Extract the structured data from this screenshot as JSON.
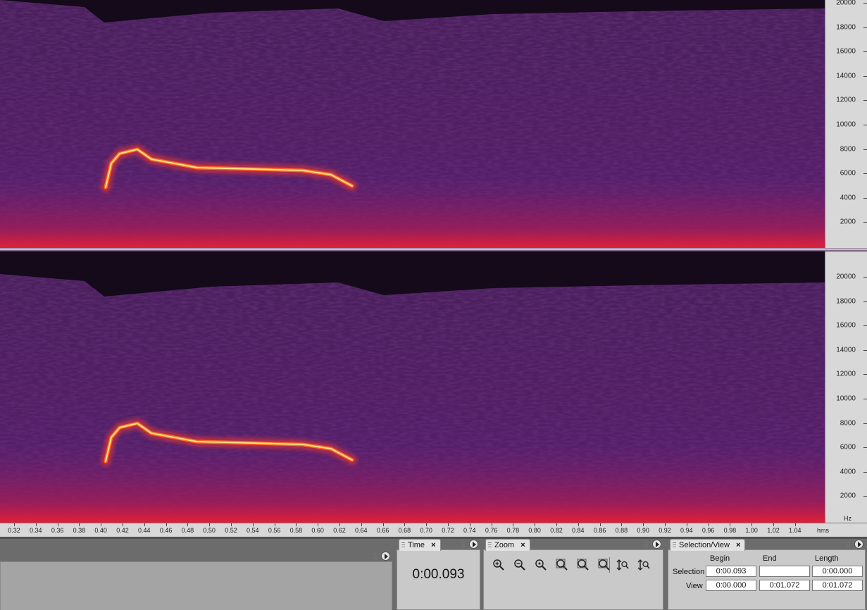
{
  "spectrogram": {
    "frequency_ruler": {
      "labels": [
        "20000",
        "18000",
        "16000",
        "14000",
        "12000",
        "10000",
        "8000",
        "6000",
        "4000",
        "2000"
      ],
      "unit": "Hz"
    },
    "time_ruler": {
      "labels": [
        "0.32",
        "0.34",
        "0.36",
        "0.38",
        "0.40",
        "0.42",
        "0.44",
        "0.46",
        "0.48",
        "0.50",
        "0.52",
        "0.54",
        "0.56",
        "0.58",
        "0.60",
        "0.62",
        "0.64",
        "0.66",
        "0.68",
        "0.70",
        "0.72",
        "0.74",
        "0.76",
        "0.78",
        "0.80",
        "0.82",
        "0.84",
        "0.86",
        "0.88",
        "0.90",
        "0.92",
        "0.94",
        "0.96",
        "0.98",
        "1.00",
        "1.02",
        "1.04"
      ],
      "unit": "hms"
    },
    "colors": {
      "background": "#4a1f5c",
      "noise_dark": "#2a0f38",
      "call_core": "#ffe07a",
      "call_edge": "#ff3a2a"
    }
  },
  "panels": {
    "time": {
      "tab_label": "Time",
      "close": "×",
      "readout": "0:00.093"
    },
    "zoom": {
      "tab_label": "Zoom",
      "close": "×",
      "tools": [
        "zoom-in-icon",
        "zoom-out-icon",
        "zoom-fit-icon",
        "zoom-selection-icon",
        "zoom-previous-icon",
        "zoom-full-icon",
        "zoom-vertical-in-icon",
        "zoom-vertical-out-icon"
      ]
    },
    "selection_view": {
      "tab_label": "Selection/View",
      "close": "×",
      "headers": {
        "begin": "Begin",
        "end": "End",
        "length": "Length"
      },
      "selection": {
        "label": "Selection",
        "begin": "0:00.093",
        "end": "",
        "length": "0:00.000"
      },
      "view": {
        "label": "View",
        "begin": "0:00.000",
        "end": "0:01.072",
        "length": "0:01.072"
      }
    }
  }
}
